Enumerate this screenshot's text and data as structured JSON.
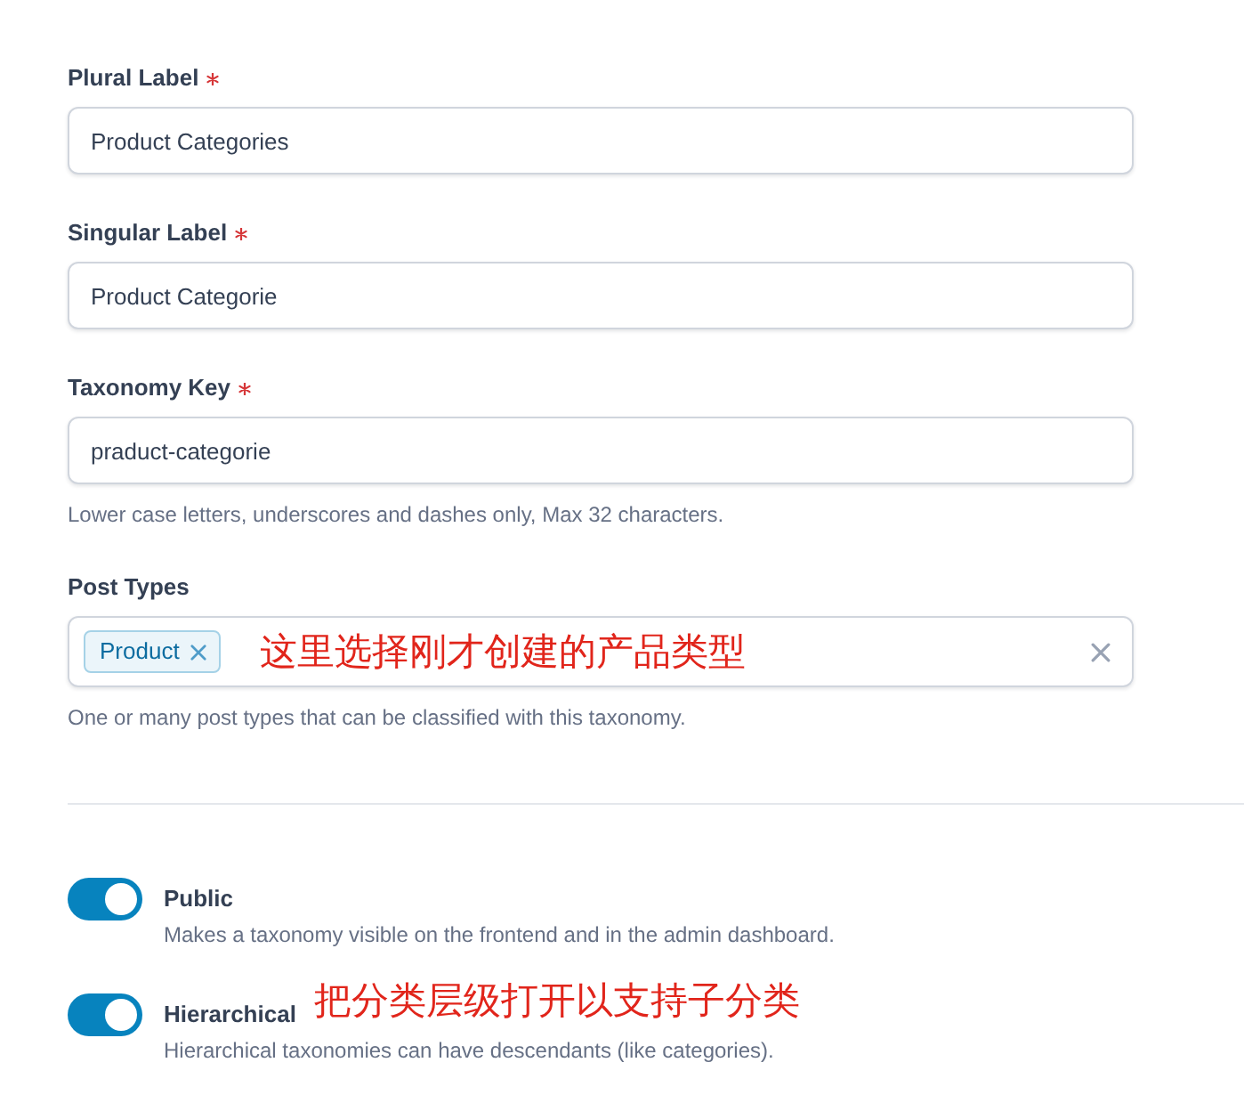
{
  "fields": [
    {
      "kind": "text",
      "label": "Plural Label",
      "required": true,
      "value": "Product Categories"
    },
    {
      "kind": "text",
      "label": "Singular Label",
      "required": true,
      "value": "Product Categorie"
    },
    {
      "kind": "text",
      "label": "Taxonomy Key",
      "required": true,
      "value": "praduct-categorie",
      "help": "Lower case letters, underscores and dashes only, Max 32 characters."
    },
    {
      "kind": "select",
      "label": "Post Types",
      "required": false,
      "tags": [
        {
          "label": "Product"
        }
      ],
      "annotation": "这里选择刚才创建的产品类型",
      "help": "One or many post types that can be classified with this taxonomy."
    }
  ],
  "toggles": [
    {
      "label": "Public",
      "on": true,
      "description": "Makes a taxonomy visible on the frontend and in the admin dashboard."
    },
    {
      "label": "Hierarchical",
      "on": true,
      "annotation": "把分类层级打开以支持子分类",
      "description": "Hierarchical taxonomies can have descendants (like categories)."
    }
  ]
}
